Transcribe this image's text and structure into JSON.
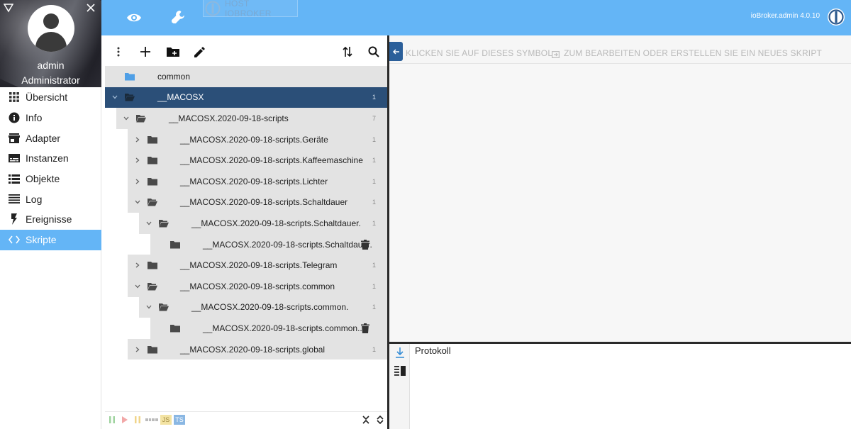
{
  "sidebar": {
    "user_name": "admin",
    "user_role": "Administrator",
    "items": [
      {
        "label": "Übersicht",
        "icon": "grid-icon",
        "active": false
      },
      {
        "label": "Info",
        "icon": "info-icon",
        "active": false
      },
      {
        "label": "Adapter",
        "icon": "store-icon",
        "active": false
      },
      {
        "label": "Instanzen",
        "icon": "instances-icon",
        "active": false
      },
      {
        "label": "Objekte",
        "icon": "list-icon",
        "active": false
      },
      {
        "label": "Log",
        "icon": "log-icon",
        "active": false
      },
      {
        "label": "Ereignisse",
        "icon": "lightning-icon",
        "active": false
      },
      {
        "label": "Skripte",
        "icon": "code-icon",
        "active": true
      }
    ]
  },
  "topbar": {
    "host_label": "HOST IOBROKER",
    "version": "ioBroker.admin 4.0.10"
  },
  "tree": {
    "rows": [
      {
        "label": "common",
        "count": "",
        "open": false,
        "chevron": "",
        "selected": false,
        "folder_color": "#4f9fe6",
        "trash": false
      },
      {
        "label": "__MACOSX",
        "count": "1",
        "open": true,
        "chevron": "down",
        "selected": true,
        "folder_color": "#1a2a3a",
        "trash": false
      },
      {
        "label": "__MACOSX.2020-09-18-scripts",
        "count": "7",
        "open": true,
        "chevron": "down",
        "selected": false,
        "folder_color": "#4a4a4a",
        "trash": false
      },
      {
        "label": "__MACOSX.2020-09-18-scripts.Geräte",
        "count": "1",
        "open": false,
        "chevron": "right",
        "selected": false,
        "folder_color": "#4a4a4a",
        "trash": false
      },
      {
        "label": "__MACOSX.2020-09-18-scripts.Kaffeemaschine",
        "count": "1",
        "open": false,
        "chevron": "right",
        "selected": false,
        "folder_color": "#4a4a4a",
        "trash": false
      },
      {
        "label": "__MACOSX.2020-09-18-scripts.Lichter",
        "count": "1",
        "open": false,
        "chevron": "right",
        "selected": false,
        "folder_color": "#4a4a4a",
        "trash": false
      },
      {
        "label": "__MACOSX.2020-09-18-scripts.Schaltdauer",
        "count": "1",
        "open": true,
        "chevron": "down",
        "selected": false,
        "folder_color": "#4a4a4a",
        "trash": false
      },
      {
        "label": "__MACOSX.2020-09-18-scripts.Schaltdauer.",
        "count": "1",
        "open": true,
        "chevron": "down",
        "selected": false,
        "folder_color": "#4a4a4a",
        "trash": false
      },
      {
        "label": "__MACOSX.2020-09-18-scripts.Schaltdauer.",
        "count": "",
        "open": false,
        "chevron": "",
        "selected": false,
        "folder_color": "#4a4a4a",
        "trash": true
      },
      {
        "label": "__MACOSX.2020-09-18-scripts.Telegram",
        "count": "1",
        "open": false,
        "chevron": "right",
        "selected": false,
        "folder_color": "#4a4a4a",
        "trash": false
      },
      {
        "label": "__MACOSX.2020-09-18-scripts.common",
        "count": "1",
        "open": true,
        "chevron": "down",
        "selected": false,
        "folder_color": "#4a4a4a",
        "trash": false
      },
      {
        "label": "__MACOSX.2020-09-18-scripts.common.",
        "count": "1",
        "open": true,
        "chevron": "down",
        "selected": false,
        "folder_color": "#4a4a4a",
        "trash": false
      },
      {
        "label": "__MACOSX.2020-09-18-scripts.common..",
        "count": "",
        "open": false,
        "chevron": "",
        "selected": false,
        "folder_color": "#4a4a4a",
        "trash": true
      },
      {
        "label": "__MACOSX.2020-09-18-scripts.global",
        "count": "1",
        "open": false,
        "chevron": "right",
        "selected": false,
        "folder_color": "#4a4a4a",
        "trash": false
      }
    ],
    "footer": {
      "js_label": "JS",
      "ts_label": "TS"
    }
  },
  "editor": {
    "hint_part1": "KLICKEN SIE AUF DIESES SYMBOL",
    "hint_part2": "ZUM BEARBEITEN ODER ERSTELLEN SIE EIN NEUES SKRIPT"
  },
  "log": {
    "title": "Protokoll"
  },
  "colors": {
    "accent": "#64b5f6",
    "selected_row": "#2b4f78",
    "row_bg": "#e3e3e3"
  }
}
